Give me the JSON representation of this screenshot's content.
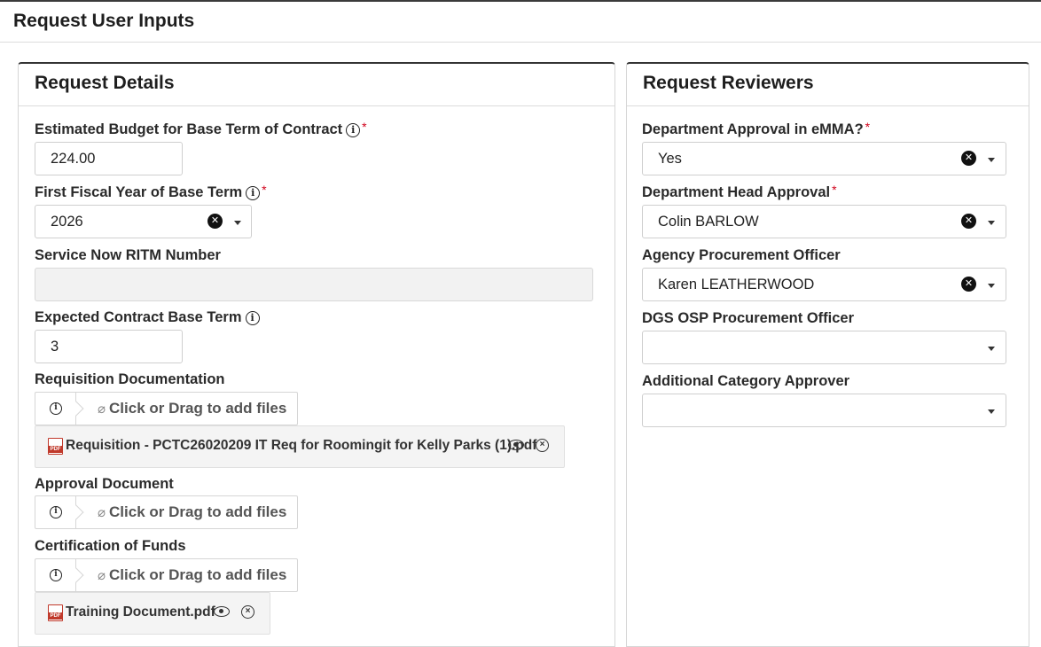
{
  "page": {
    "title": "Request User Inputs"
  },
  "details": {
    "title": "Request Details",
    "budget": {
      "label": "Estimated Budget for Base Term of Contract",
      "required": "*",
      "value": "224.00"
    },
    "fiscal_year": {
      "label": "First Fiscal Year of Base Term",
      "required": "*",
      "value": "2026"
    },
    "ritm": {
      "label": "Service Now RITM Number",
      "value": ""
    },
    "base_term": {
      "label": "Expected Contract Base Term",
      "value": "3"
    },
    "requisition": {
      "label": "Requisition Documentation",
      "upload_text": "Click or Drag to add files",
      "file_name": "Requisition - PCTC26020209 IT Req for Roomingit for Kelly Parks (1).pdf"
    },
    "approval": {
      "label": "Approval Document",
      "upload_text": "Click or Drag to add files"
    },
    "funds": {
      "label": "Certification of Funds",
      "upload_text": "Click or Drag to add files",
      "file_name": "Training Document.pdf"
    }
  },
  "reviewers": {
    "title": "Request Reviewers",
    "emma": {
      "label": "Department Approval in eMMA?",
      "required": "*",
      "value": "Yes"
    },
    "dept_head": {
      "label": "Department Head Approval",
      "required": "*",
      "value": "Colin BARLOW"
    },
    "agency_po": {
      "label": "Agency Procurement Officer",
      "value": "Karen LEATHERWOOD"
    },
    "dgs_po": {
      "label": "DGS OSP Procurement Officer",
      "value": ""
    },
    "category_approver": {
      "label": "Additional Category Approver",
      "value": ""
    }
  },
  "icons": {
    "info": "info-icon",
    "clear": "clear-icon",
    "caret": "caret-down-icon",
    "paperclip": "paperclip-icon",
    "pdf": "pdf-file-icon",
    "eye": "eye-icon",
    "remove": "remove-circle-icon"
  },
  "colors": {
    "required": "#d0021b",
    "pdf_red": "#c0392b",
    "disabled_bg": "#f2f2f2"
  }
}
